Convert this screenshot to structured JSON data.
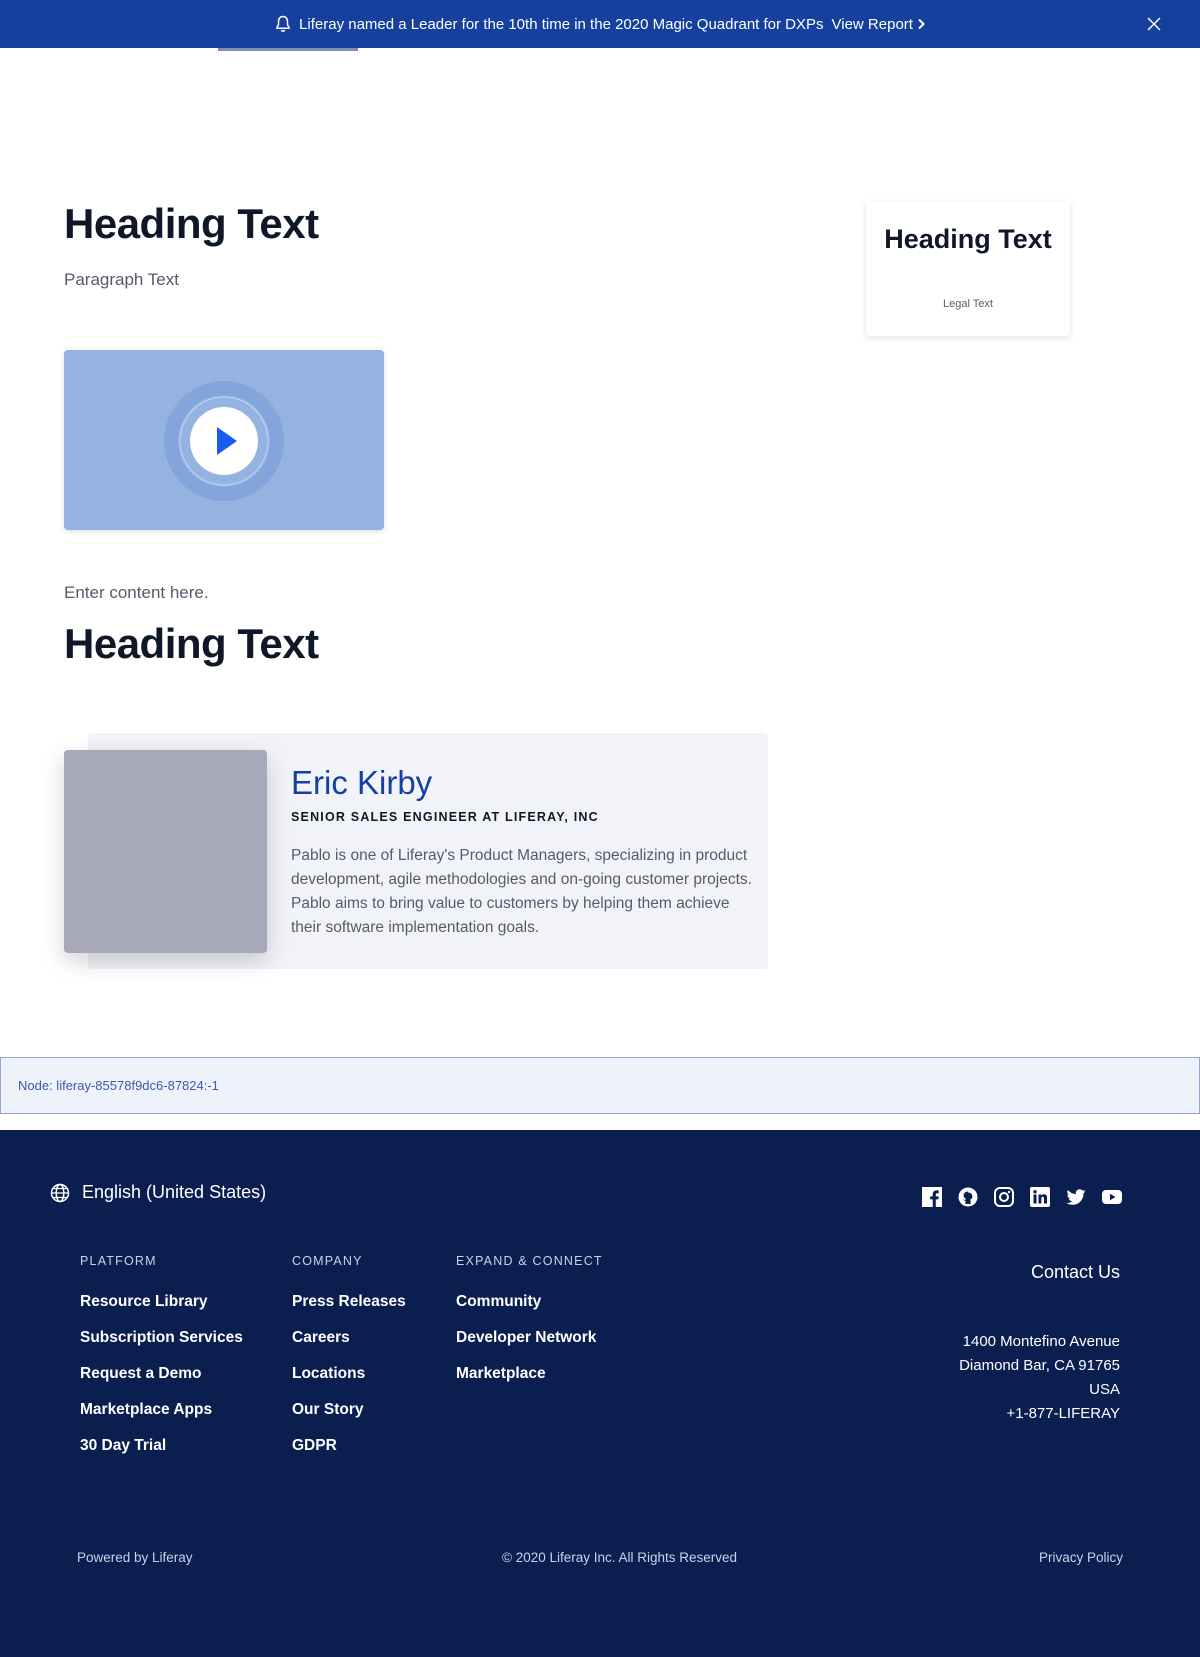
{
  "announcement": {
    "text": "Liferay named a Leader for the 10th time in the 2020 Magic Quadrant for DXPs",
    "link_label": "View Report",
    "bg_color": "#16409e"
  },
  "main": {
    "heading_1": "Heading Text",
    "paragraph": "Paragraph Text",
    "card": {
      "heading": "Heading Text",
      "legal": "Legal Text"
    },
    "content_placeholder": "Enter content here.",
    "heading_2": "Heading Text"
  },
  "profile": {
    "name": "Eric Kirby",
    "role": "SENIOR SALES ENGINEER AT LIFERAY, INC",
    "bio": "Pablo is one of Liferay's Product Managers, specializing in product development, agile methodologies and on-going customer projects. Pablo aims to bring value to customers by helping them achieve their software implementation goals."
  },
  "node": {
    "text": "Node: liferay-85578f9dc6-87824:-1"
  },
  "footer": {
    "language": "English (United States)",
    "socials": [
      "facebook-icon",
      "github-icon",
      "instagram-icon",
      "linkedin-icon",
      "twitter-icon",
      "youtube-icon"
    ],
    "columns": [
      {
        "heading": "PLATFORM",
        "items": [
          "Resource Library",
          "Subscription Services",
          "Request a Demo",
          "Marketplace Apps",
          "30 Day Trial"
        ]
      },
      {
        "heading": "COMPANY",
        "items": [
          "Press Releases",
          "Careers",
          "Locations",
          "Our Story",
          "GDPR"
        ]
      },
      {
        "heading": "EXPAND & CONNECT",
        "items": [
          "Community",
          "Developer Network",
          "Marketplace"
        ]
      }
    ],
    "contact_label": "Contact Us",
    "address": [
      "1400 Montefino Avenue",
      "Diamond Bar, CA 91765",
      "USA",
      "+1-877-LIFERAY"
    ],
    "powered_by": "Powered by Liferay",
    "copyright": "© 2020 Liferay Inc. All Rights Reserved",
    "privacy": "Privacy Policy",
    "bg_color": "#0a1e50"
  }
}
